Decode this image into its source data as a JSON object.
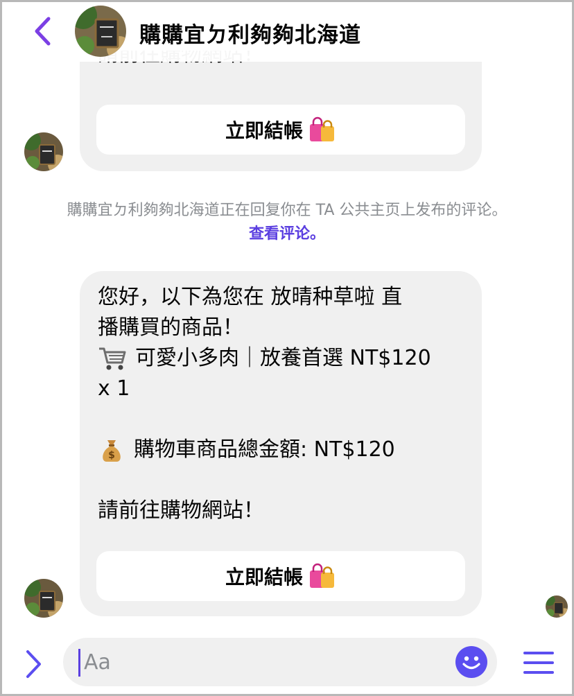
{
  "header": {
    "title": "購購宜ㄉ利夠夠北海道"
  },
  "messages": [
    {
      "partial_text": "請前往購物網站！",
      "button_label": "立即結帳",
      "button_emoji": "shopping-bags-icon"
    },
    {
      "lines": [
        "您好，以下為您在 放晴种草啦 直",
        "播購買的商品！",
        "可愛小多肉｜放養首選 NT$120",
        "x 1",
        "",
        "購物車商品總金額: NT$120",
        "",
        "請前往購物網站！"
      ],
      "line_emojis": {
        "2": "shopping-cart-icon",
        "5": "money-bag-icon"
      },
      "button_label": "立即結帳",
      "button_emoji": "shopping-bags-icon"
    }
  ],
  "notice": {
    "text": "購購宜ㄉ利夠夠北海道正在回复你在 TA 公共主页上发布的评论。",
    "link": "查看评论。"
  },
  "composer": {
    "placeholder": "Aa"
  },
  "colors": {
    "accent": "#5b4ef0",
    "bubble": "#f0f0f0",
    "notice": "#8a8d91"
  }
}
